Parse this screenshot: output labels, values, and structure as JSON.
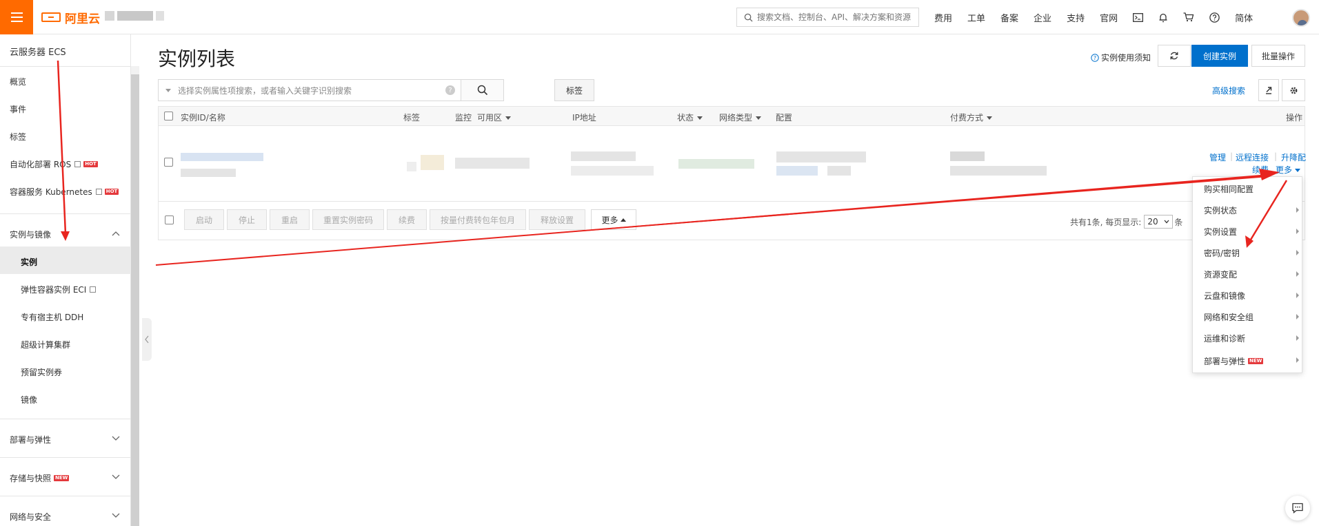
{
  "brand": {
    "logo_text": "阿里云",
    "accent_color": "#ff6a00",
    "icon": "aliyun-logo-icon"
  },
  "top_search": {
    "placeholder": "搜索文档、控制台、API、解决方案和资源",
    "icon": "search-icon"
  },
  "top_nav": [
    "费用",
    "工单",
    "备案",
    "企业",
    "支持",
    "官网"
  ],
  "top_icons": [
    "terminal-icon",
    "bell-icon",
    "cart-icon",
    "help-icon"
  ],
  "lang_label": "简体",
  "sidebar": {
    "title": "云服务器 ECS",
    "items": [
      {
        "label": "概览"
      },
      {
        "label": "事件"
      },
      {
        "label": "标签"
      },
      {
        "label": "自动化部署 ROS",
        "badge": "HOT"
      },
      {
        "label": "容器服务 Kubernetes",
        "badge": "HOT"
      }
    ],
    "group_instances": "实例与镜像",
    "sub_items": [
      {
        "label": "实例",
        "active": true
      },
      {
        "label": "弹性容器实例 ECI"
      },
      {
        "label": "专有宿主机 DDH"
      },
      {
        "label": "超级计算集群"
      },
      {
        "label": "预留实例券"
      },
      {
        "label": "镜像"
      }
    ],
    "groups": [
      {
        "label": "部署与弹性"
      },
      {
        "label": "存储与快照",
        "badge": "NEW"
      },
      {
        "label": "网络与安全"
      }
    ]
  },
  "main": {
    "title": "实例列表",
    "notice": "实例使用须知",
    "create_button": "创建实例",
    "batch_button": "批量操作",
    "filter_placeholder": "选择实例属性项搜索，或者输入关键字识别搜索",
    "tag_button": "标签",
    "advanced_search": "高级搜索",
    "primary_color": "#0070cc"
  },
  "table": {
    "columns": [
      "实例ID/名称",
      "标签",
      "监控",
      "可用区",
      "IP地址",
      "状态",
      "网络类型",
      "配置",
      "付费方式",
      "操作"
    ],
    "row_ops": {
      "manage": "管理",
      "remote": "远程连接",
      "upgrade": "升降配",
      "renew": "续费",
      "more": "更多"
    }
  },
  "batch_actions": [
    "启动",
    "停止",
    "重启",
    "重置实例密码",
    "续费",
    "按量付费转包年包月",
    "释放设置",
    "更多"
  ],
  "pagination": {
    "prefix": "共有1条, 每页显示:",
    "page_size": "20",
    "suffix": "条"
  },
  "more_menu": [
    "购买相同配置",
    "实例状态",
    "实例设置",
    "密码/密钥",
    "资源变配",
    "云盘和镜像",
    "网络和安全组",
    "运维和诊断",
    "部署与弹性"
  ],
  "more_menu_badge": "NEW",
  "annotation_color": "#e8251f"
}
